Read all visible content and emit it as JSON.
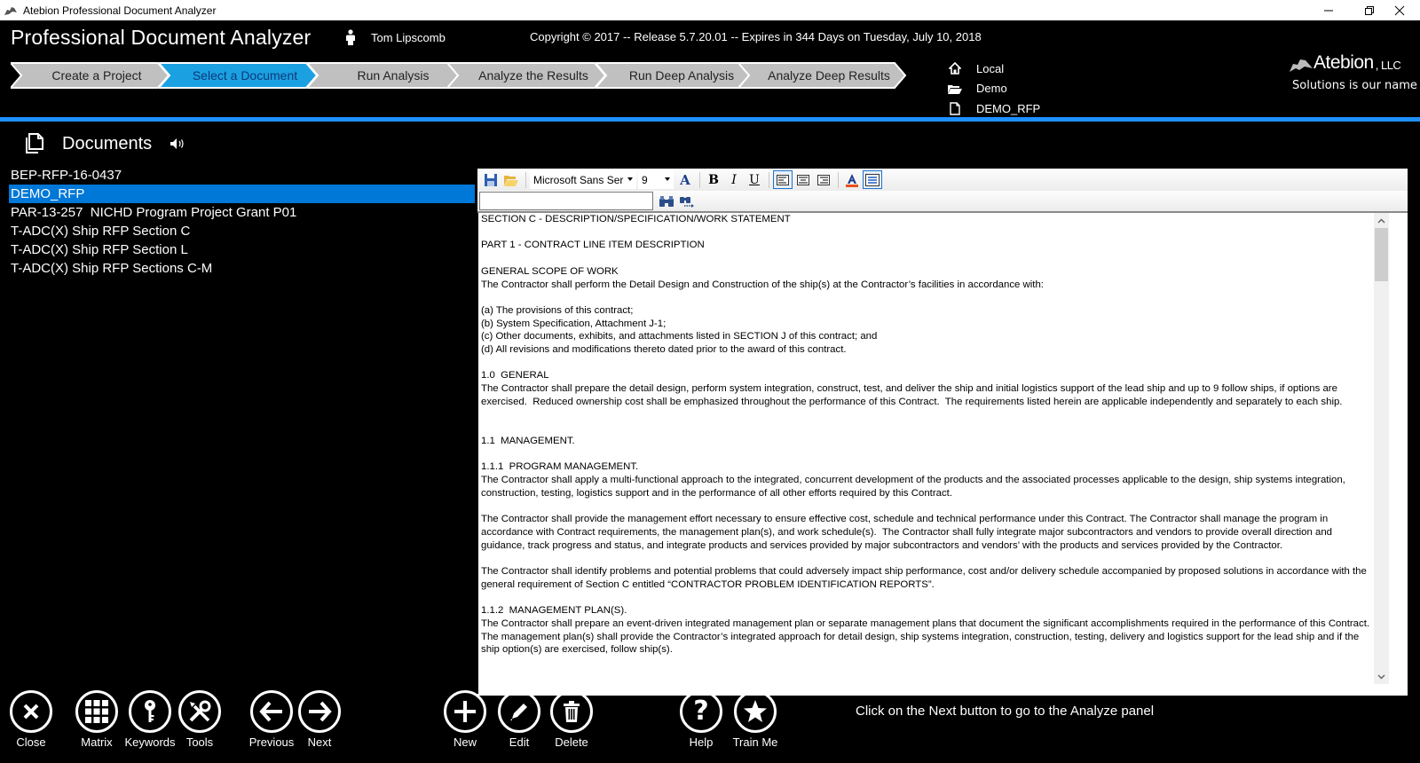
{
  "window": {
    "title": "Atebion Professional Document Analyzer",
    "minimize_icon": "minimize-icon",
    "maximize_icon": "restore-icon",
    "close_icon": "close-icon"
  },
  "header": {
    "app_title": "Professional Document Analyzer",
    "user_name": "Tom Lipscomb",
    "copyright": "Copyright © 2017 -- Release 5.7.20.01 -- Expires in 344 Days on Tuesday, July 10, 2018",
    "steps": [
      {
        "label": "Create a Project",
        "active": false
      },
      {
        "label": "Select a Document",
        "active": true
      },
      {
        "label": "Run Analysis",
        "active": false
      },
      {
        "label": "Analyze the Results",
        "active": false
      },
      {
        "label": "Run Deep Analysis",
        "active": false
      },
      {
        "label": "Analyze Deep Results",
        "active": false
      }
    ],
    "location": {
      "storage": "Local",
      "project": "Demo",
      "document": "DEMO_RFP"
    },
    "brand": {
      "name": "Atebion",
      "suffix": ", LLC",
      "tagline": "Solutions is our name"
    }
  },
  "colors": {
    "accent_blue": "#1e90ff",
    "step_active": "#1ba1e2",
    "step_inactive": "#c0c0c0",
    "selection": "#0078d7"
  },
  "documents": {
    "title": "Documents",
    "items": [
      {
        "label": "BEP-RFP-16-0437",
        "selected": false
      },
      {
        "label": "DEMO_RFP",
        "selected": true
      },
      {
        "label": "PAR-13-257  NICHD Program Project Grant P01",
        "selected": false
      },
      {
        "label": "T-ADC(X) Ship RFP Section C",
        "selected": false
      },
      {
        "label": "T-ADC(X) Ship RFP Section L",
        "selected": false
      },
      {
        "label": "T-ADC(X) Ship RFP Sections C-M",
        "selected": false
      }
    ]
  },
  "editor": {
    "toolbar": {
      "font_name": "Microsoft Sans Ser",
      "font_size": "9",
      "bold": "B",
      "italic": "I",
      "underline": "U",
      "search_value": "",
      "search_placeholder": ""
    },
    "paragraphs": [
      "SECTION C - DESCRIPTION/SPECIFICATION/WORK STATEMENT",
      "",
      "PART 1 - CONTRACT LINE ITEM DESCRIPTION",
      "",
      "GENERAL SCOPE OF WORK",
      "The Contractor shall perform the Detail Design and Construction of the ship(s) at the Contractor’s facilities in accordance with:",
      "",
      "(a) The provisions of this contract;",
      "(b) System Specification, Attachment J-1;",
      "(c) Other documents, exhibits, and attachments listed in SECTION J of this contract; and",
      "(d) All revisions and modifications thereto dated prior to the award of this contract.",
      "",
      "1.0  GENERAL",
      "The Contractor shall prepare the detail design, perform system integration, construct, test, and deliver the ship and initial logistics support of the lead ship and up to 9 follow ships, if options are exercised.  Reduced ownership cost shall be emphasized throughout the performance of this Contract.  The requirements listed herein are applicable independently and separately to each ship.",
      "",
      "",
      "1.1  MANAGEMENT.",
      "",
      "1.1.1  PROGRAM MANAGEMENT.",
      "The Contractor shall apply a multi-functional approach to the integrated, concurrent development of the products and the associated processes applicable to the design, ship systems integration, construction, testing, logistics support and in the performance of all other efforts required by this Contract.",
      "",
      "The Contractor shall provide the management effort necessary to ensure effective cost, schedule and technical performance under this Contract. The Contractor shall manage the program in accordance with Contract requirements, the management plan(s), and work schedule(s).  The Contractor shall fully integrate major subcontractors and vendors to provide overall direction and guidance, track progress and status, and integrate products and services provided by major subcontractors and vendors’ with the products and services provided by the Contractor.",
      "",
      "The Contractor shall identify problems and potential problems that could adversely impact ship performance, cost and/or delivery schedule accompanied by proposed solutions in accordance with the general requirement of Section C entitled “CONTRACTOR PROBLEM IDENTIFICATION REPORTS”.",
      "",
      "1.1.2  MANAGEMENT PLAN(S).",
      "The Contractor shall prepare an event-driven integrated management plan or separate management plans that document the significant accomplishments required in the performance of this Contract.  The management plan(s) shall provide the Contractor’s integrated approach for detail design, ship systems integration, construction, testing, delivery and logistics support for the lead ship and if the ship option(s) are exercised, follow ship(s)."
    ]
  },
  "bottom_bar": {
    "buttons": [
      {
        "label": "Close",
        "icon": "close-icon"
      },
      {
        "label": "Matrix",
        "icon": "grid-icon"
      },
      {
        "label": "Keywords",
        "icon": "key-icon"
      },
      {
        "label": "Tools",
        "icon": "tools-icon"
      },
      {
        "label": "Previous",
        "icon": "arrow-left-icon"
      },
      {
        "label": "Next",
        "icon": "arrow-right-icon"
      },
      {
        "label": "New",
        "icon": "plus-icon"
      },
      {
        "label": "Edit",
        "icon": "pencil-icon"
      },
      {
        "label": "Delete",
        "icon": "trash-icon"
      },
      {
        "label": "Help",
        "icon": "help-icon"
      },
      {
        "label": "Train Me",
        "icon": "star-icon"
      }
    ],
    "status_message": "Click on the Next button to go to the Analyze panel"
  }
}
